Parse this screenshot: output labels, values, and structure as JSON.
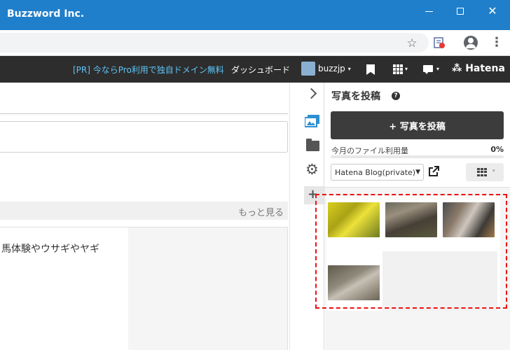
{
  "window": {
    "title": "Buzzword Inc.",
    "minimize_label": "",
    "close_glyph": "✕"
  },
  "browser": {
    "star_icon": "☆",
    "kebab_glyph": "⋮"
  },
  "hatena_header": {
    "promo": "[PR] 今ならPro利用で独自ドメイン無料",
    "dashboard": "ダッシュボード",
    "username": "buzzjp",
    "caret": "▾",
    "logo": "⁂ Hatena"
  },
  "editor": {
    "more_link": "もっと見る",
    "body_text": "馬体験やウサギやヤギ"
  },
  "side_icons": [
    "chevron-right-icon",
    "photo-icon",
    "folder-icon",
    "gear-icon",
    "plus-icon"
  ],
  "gear_glyph": "⚙",
  "plus_glyph": "+",
  "panel": {
    "title": "写真を投稿",
    "help": "?",
    "post_button": "+ 写真を投稿",
    "usage_label": "今月のファイル利用量",
    "usage_percent": "0%",
    "usage_fraction": 0,
    "blog_select": "Hatena Blog(private)",
    "select_arrow": "▼",
    "toggle_caret": "▾"
  },
  "photos": [
    {
      "name": "yellow-flowers"
    },
    {
      "name": "rabbit-on-ground"
    },
    {
      "name": "animals-in-pen"
    },
    {
      "name": "sheep-in-pen"
    }
  ],
  "colors": {
    "titlebar": "#1f7fcb",
    "header": "#2d2d2d",
    "promo_link": "#5fc5f7",
    "post_button": "#3c3c3c",
    "selection_outline": "#ee1111"
  }
}
